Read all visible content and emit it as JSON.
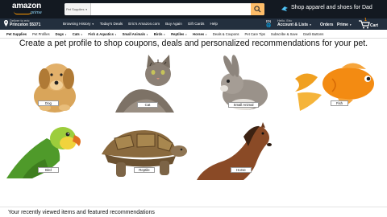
{
  "header": {
    "logo_text": "amazon",
    "logo_sub": "prime",
    "search_category": "Pet Supplies",
    "search_placeholder": "",
    "promo_text": "Shop apparel and shoes for Dad",
    "accent_color": "#febd69"
  },
  "delivery": {
    "line1": "Deliver to eric",
    "line2": "Princeton 55371"
  },
  "nav_links": [
    "Browsing History",
    "Today's Deals",
    "Eric's Amazon.com",
    "Buy Again",
    "Gift Cards",
    "Help"
  ],
  "account": {
    "lang": "EN",
    "hello": "Hello, Eric",
    "account_lists": "Account & Lists",
    "orders": "Orders",
    "prime": "Prime",
    "cart_count": "1",
    "cart_label": "Cart"
  },
  "subnav": [
    "Pet Supplies",
    "Pet Profiles",
    "Dogs",
    "Cats",
    "Fish & Aquatics",
    "Small Animals",
    "Birds",
    "Reptiles",
    "Horses",
    "Deals & Coupons",
    "Pet Care Tips",
    "Subscribe & Save",
    "Dash Buttons"
  ],
  "headline": "Create a pet profile to shop coupons, deals and personalized recommendations for your pet.",
  "pets": [
    {
      "label": "Dog",
      "icon": "dog-image"
    },
    {
      "label": "Cat",
      "icon": "cat-image"
    },
    {
      "label": "Small Animal",
      "icon": "rabbit-image"
    },
    {
      "label": "Fish",
      "icon": "goldfish-image"
    },
    {
      "label": "Bird",
      "icon": "parrot-image"
    },
    {
      "label": "Reptile",
      "icon": "tortoise-image"
    },
    {
      "label": "Horse",
      "icon": "horse-image"
    }
  ],
  "footer": {
    "text": "Your recently viewed items and featured recommendations"
  }
}
